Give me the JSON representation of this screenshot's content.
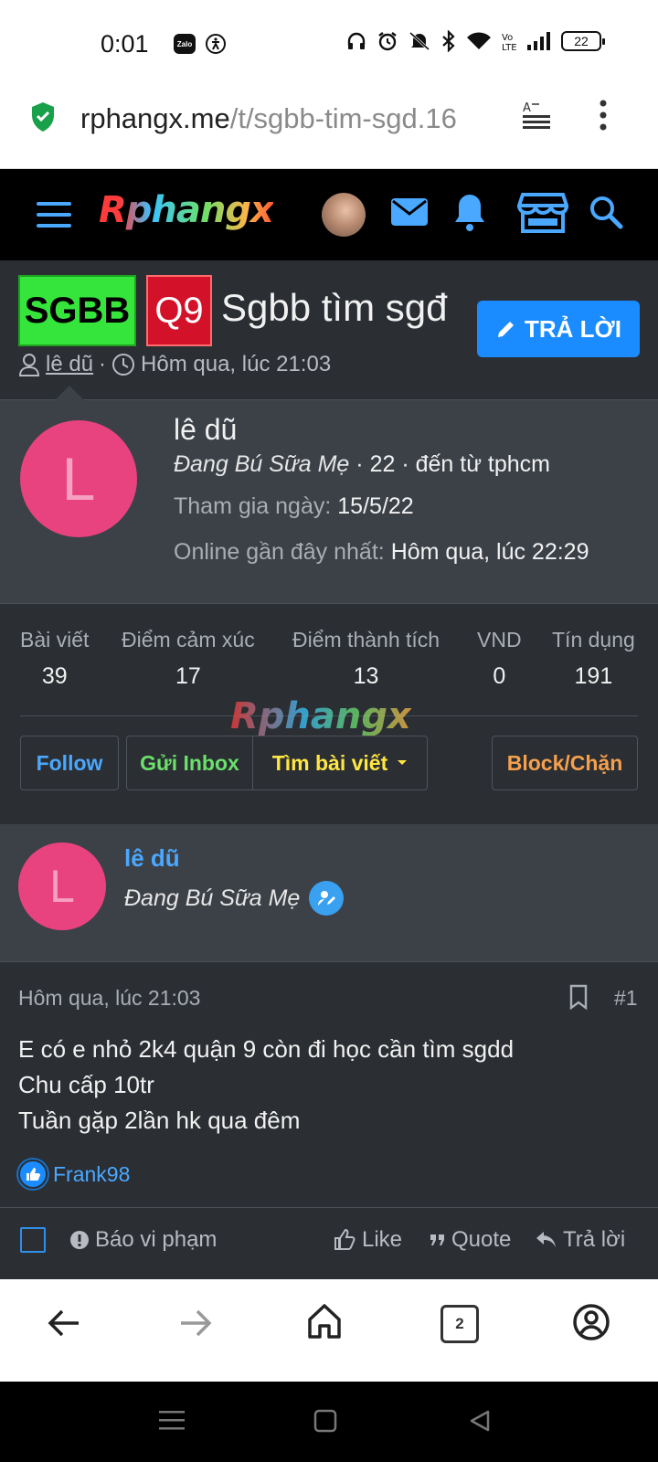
{
  "status_bar": {
    "time": "0:01",
    "zalo_label": "Zalo",
    "battery": "22",
    "icons": [
      "zalo-icon",
      "accessibility-icon",
      "headphones-icon",
      "alarm-icon",
      "mute-icon",
      "bluetooth-icon",
      "wifi-icon",
      "volte-icon",
      "signal-icon",
      "battery-icon"
    ]
  },
  "browser": {
    "url_domain": "rphangx.me",
    "url_path": "/t/sgbb-tim-sgd.16",
    "tab_count": "2"
  },
  "site": {
    "logo": "Rphangx",
    "header_icons": [
      "menu-icon",
      "avatar",
      "mail-icon",
      "bell-icon",
      "store-icon",
      "search-icon"
    ]
  },
  "thread": {
    "prefix_1": "SGBB",
    "prefix_2": "Q9",
    "title": "Sgbb tìm sgđ",
    "reply_button": "TRẢ LỜI",
    "author": "lê dũ",
    "separator": "·",
    "date": "Hôm qua, lúc 21:03"
  },
  "member_card": {
    "avatar_letter": "L",
    "name": "lê dũ",
    "user_title": "Đang Bú Sữa Mẹ",
    "title_extra": "· 22 · đến từ tphcm",
    "joined_label": "Tham gia ngày:",
    "joined_value": "15/5/22",
    "last_seen_label": "Online gần đây nhất:",
    "last_seen_value": "Hôm qua, lúc 22:29",
    "stats": [
      {
        "label": "Bài viết",
        "value": "39"
      },
      {
        "label": "Điểm cảm xúc",
        "value": "17"
      },
      {
        "label": "Điểm thành tích",
        "value": "13"
      },
      {
        "label": "VND",
        "value": "0"
      },
      {
        "label": "Tín dụng",
        "value": "191"
      }
    ],
    "watermark": "Rphangx",
    "buttons": {
      "follow": "Follow",
      "inbox": "Gửi Inbox",
      "find_posts": "Tìm bài viết",
      "block": "Block/Chặn"
    }
  },
  "post": {
    "author_avatar_letter": "L",
    "author_name": "lê dũ",
    "author_title": "Đang Bú Sữa Mẹ",
    "date": "Hôm qua, lúc 21:03",
    "number": "#1",
    "lines": [
      "E có e nhỏ 2k4 quận 9 còn đi học cần tìm sgdd",
      "Chu cấp 10tr",
      "Tuần gặp 2lần hk qua đêm"
    ],
    "reaction_user": "Frank98",
    "actions": {
      "report": "Báo vi phạm",
      "like": "Like",
      "quote": "Quote",
      "reply": "Trả lời"
    }
  },
  "colors": {
    "accent_blue": "#1a8cff",
    "prefix_green": "#35e53b",
    "prefix_red": "#d3122a",
    "avatar_pink": "#e8437f",
    "follow_blue": "#4aa8ff",
    "inbox_green": "#6be06b",
    "posts_yellow": "#ffe642",
    "block_orange": "#f6a04d"
  }
}
